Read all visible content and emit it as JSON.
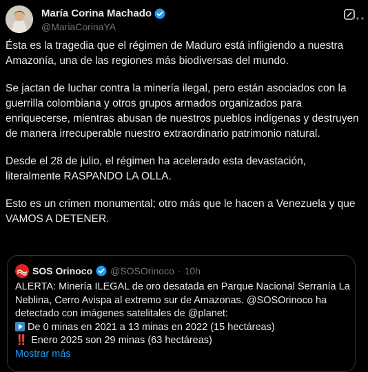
{
  "author": {
    "name": "María Corina Machado",
    "handle": "@MariaCorinaYA"
  },
  "tweet": {
    "paragraphs": [
      "Ésta es la tragedia que el régimen de Maduro está infligiendo a nuestra Amazonía, una de las regiones más biodiversas del mundo.",
      "Se jactan de luchar contra la minería ilegal, pero están asociados con la guerrilla colombiana y otros grupos armados organizados para enriquecerse, mientras abusan de nuestros pueblos indígenas y destruyen de manera irrecuperable nuestro extraordinario patrimonio natural.",
      "Desde el 28 de julio, el régimen ha acelerado esta devastación, literalmente RASPANDO LA OLLA.",
      "Esto es un crimen monumental; otro más que le hacen a Venezuela y que VAMOS A DETENER."
    ]
  },
  "quote": {
    "name": "SOS Orinoco",
    "handle": "@SOSOrinoco",
    "separator": "·",
    "time": "10h",
    "lines": [
      "ALERTA: Minería ILEGAL de oro desatada en Parque Nacional Serranía La",
      "Neblina, Cerro Avispa al extremo sur de Amazonas. @SOSOrinoco ha",
      "detectado con imágenes satelitales de @planet:",
      "De 0 minas en 2021 a 13 minas en 2022 (15 hectáreas)",
      "Enero 2025 son 29 minas (63 hectáreas)"
    ],
    "line4_emoji": "arrow-right-emoji",
    "line5_emoji": "‼️",
    "more_label": "Mostrar más"
  },
  "colors": {
    "background": "#000000",
    "text": "#e7e9ea",
    "secondary": "#71767b",
    "accent": "#1d9bf0",
    "border": "#2f3336"
  }
}
